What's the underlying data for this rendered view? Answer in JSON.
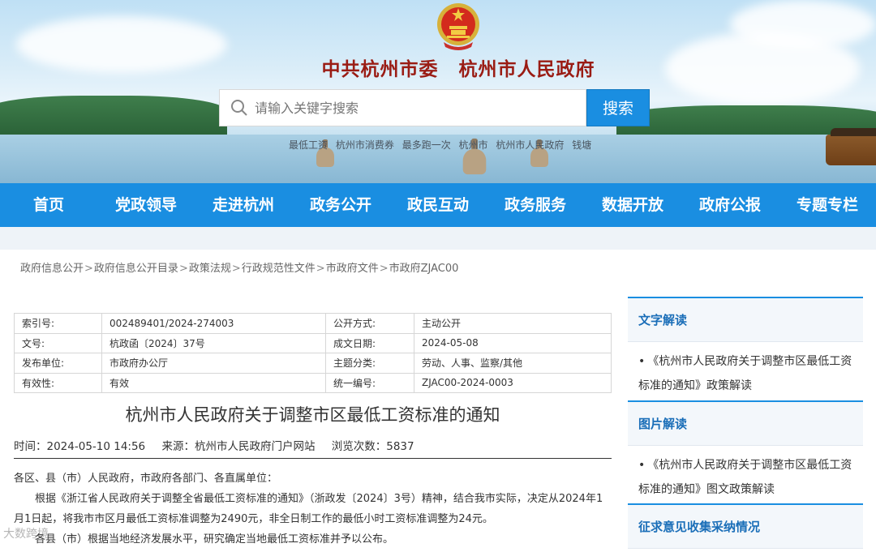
{
  "header": {
    "title_left": "中共杭州市委",
    "title_right": "杭州市人民政府",
    "search": {
      "placeholder": "请输入关键字搜索",
      "button_label": "搜索"
    },
    "hot_words": [
      "最低工资",
      "杭州市消费券",
      "最多跑一次",
      "杭州市",
      "杭州市人民政府",
      "钱塘"
    ]
  },
  "nav": {
    "items": [
      "首页",
      "党政领导",
      "走进杭州",
      "政务公开",
      "政民互动",
      "政务服务",
      "数据开放",
      "政府公报",
      "专题专栏"
    ]
  },
  "breadcrumb": [
    "政府信息公开",
    "政府信息公开目录",
    "政策法规",
    "行政规范性文件",
    "市政府文件",
    "市政府ZJAC00"
  ],
  "meta": {
    "rows": [
      {
        "k1": "索引号:",
        "v1": "002489401/2024-274003",
        "k2": "公开方式:",
        "v2": "主动公开"
      },
      {
        "k1": "文号:",
        "v1": "杭政函〔2024〕37号",
        "k2": "成文日期:",
        "v2": "2024-05-08"
      },
      {
        "k1": "发布单位:",
        "v1": "市政府办公厅",
        "k2": "主题分类:",
        "v2": "劳动、人事、监察/其他"
      },
      {
        "k1": "有效性:",
        "v1": "有效",
        "k2": "统一编号:",
        "v2": "ZJAC00-2024-0003"
      }
    ]
  },
  "document": {
    "title": "杭州市人民政府关于调整市区最低工资标准的通知",
    "time": "时间：2024-05-10 14:56",
    "source": "来源：杭州市人民政府门户网站",
    "views": "浏览次数：5837",
    "paragraphs": [
      "各区、县（市）人民政府，市政府各部门、各直属单位：",
      "根据《浙江省人民政府关于调整全省最低工资标准的通知》（浙政发〔2024〕3号）精神，结合我市实际，决定从2024年1月1日起，将我市市区月最低工资标准调整为2490元，非全日制工作的最低小时工资标准调整为24元。",
      "各县（市）根据当地经济发展水平，研究确定当地最低工资标准并予以公布。"
    ]
  },
  "sidebar": {
    "sections": [
      {
        "title": "文字解读",
        "item": "《杭州市人民政府关于调整市区最低工资标准的通知》政策解读"
      },
      {
        "title": "图片解读",
        "item": "《杭州市人民政府关于调整市区最低工资标准的通知》图文政策解读"
      },
      {
        "title": "征求意见收集采纳情况"
      }
    ]
  },
  "watermark": "大数跨境",
  "colors": {
    "nav_blue": "#1a8ee1",
    "title_red": "#9a1c14",
    "side_head_blue": "#1a6eb8"
  }
}
